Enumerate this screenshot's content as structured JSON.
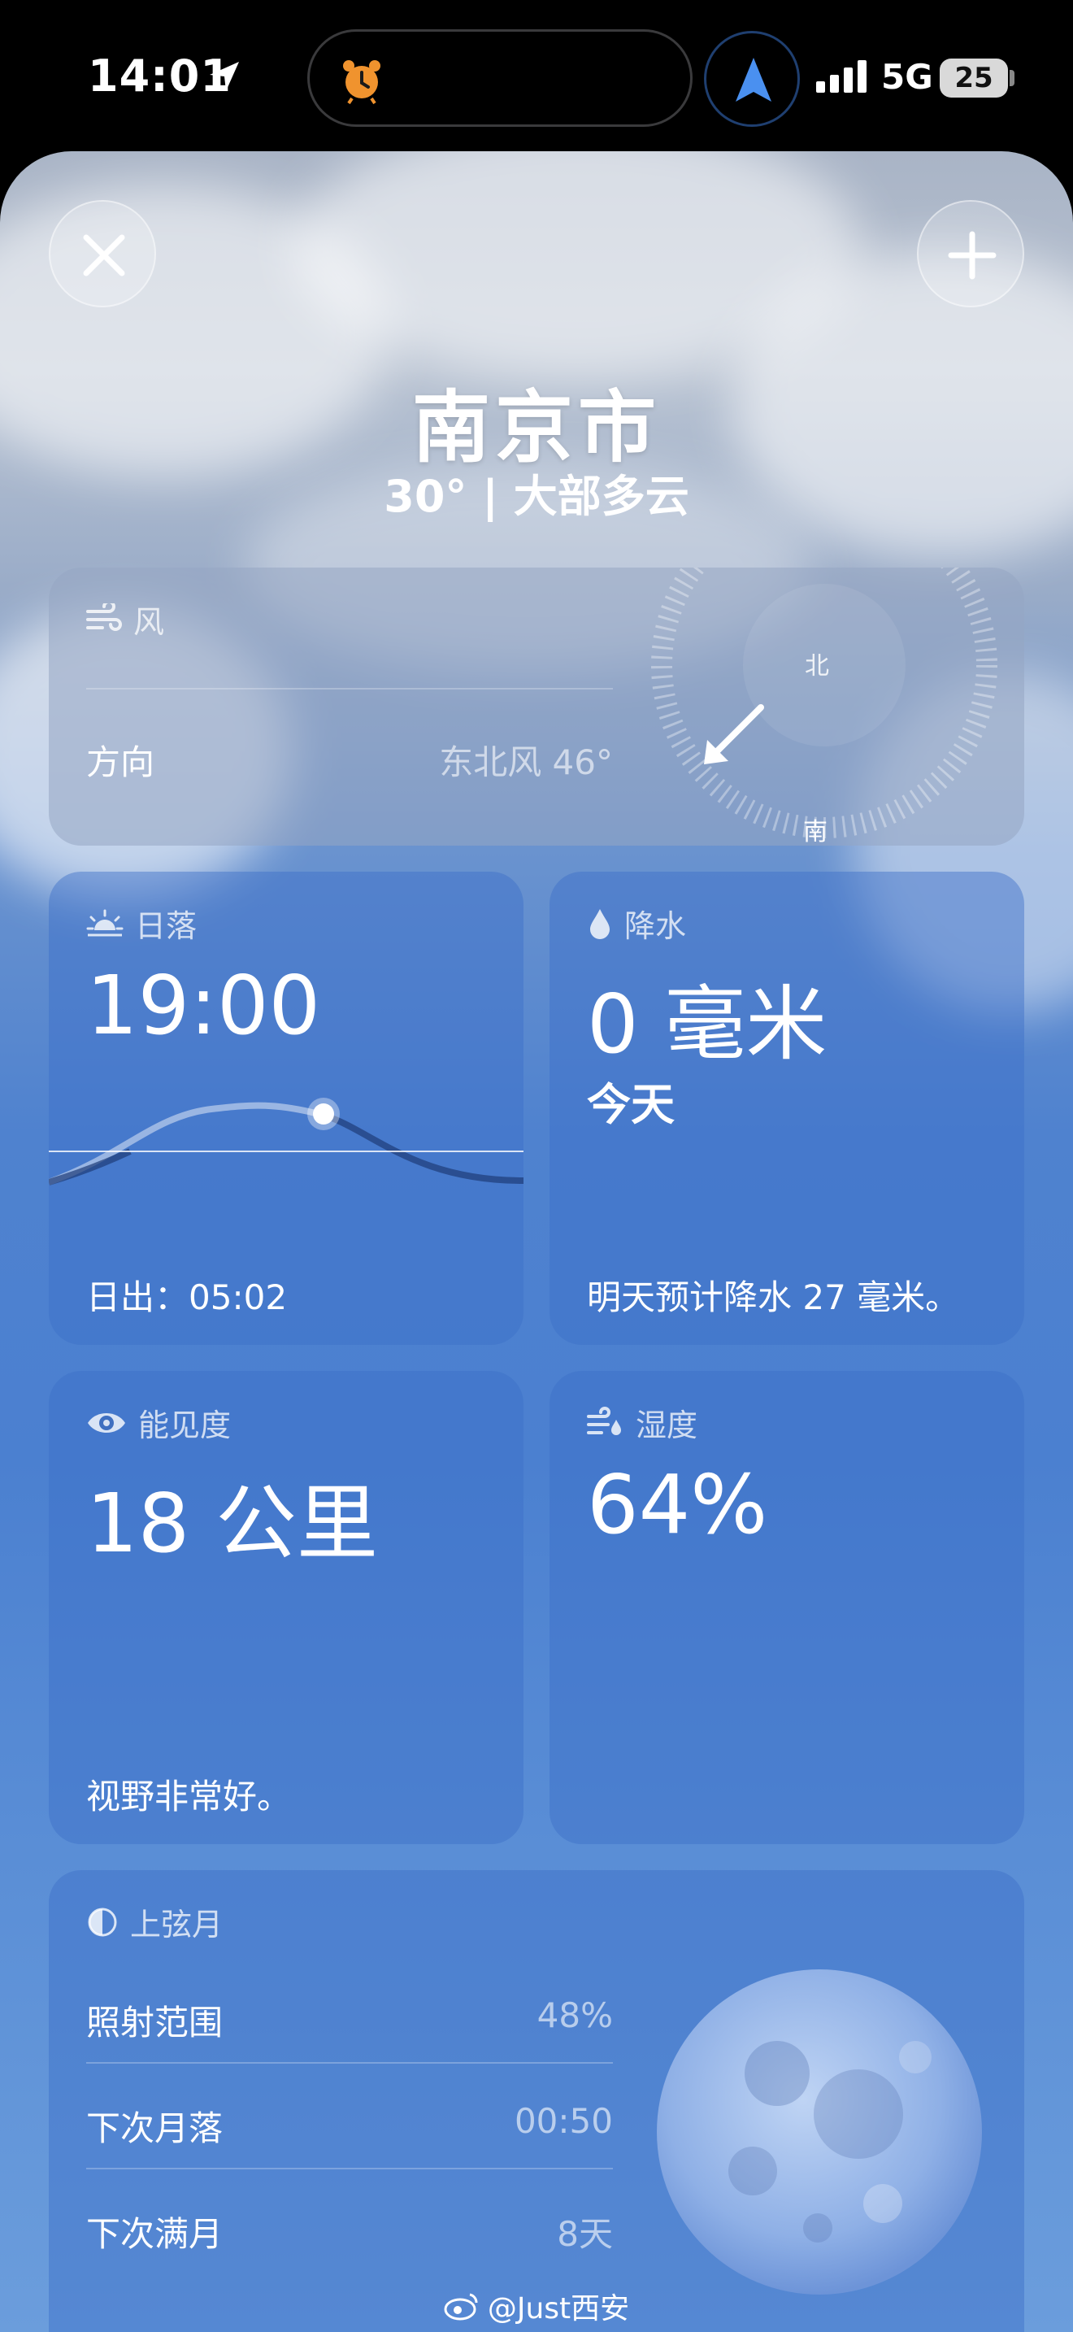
{
  "status_bar": {
    "time": "14:01",
    "network": "5G",
    "battery": "25"
  },
  "header": {
    "city": "南京市",
    "condition": "30° | 大部多云"
  },
  "wind": {
    "title": "风",
    "direction_label": "方向",
    "direction_value": "东北风 46°",
    "compass_north": "北",
    "compass_south": "南"
  },
  "sunset": {
    "title": "日落",
    "time": "19:00",
    "sunrise": "日出：05:02"
  },
  "precipitation": {
    "title": "降水",
    "amount": "0 毫米",
    "period": "今天",
    "note": "明天预计降水 27 毫米。"
  },
  "visibility": {
    "title": "能见度",
    "value": "18 公里",
    "note": "视野非常好。"
  },
  "humidity": {
    "title": "湿度",
    "value": "64%"
  },
  "moon": {
    "title": "上弦月",
    "rows": [
      {
        "label": "照射范围",
        "value": "48%"
      },
      {
        "label": "下次月落",
        "value": "00:50"
      },
      {
        "label": "下次满月",
        "value": "8天"
      }
    ]
  },
  "watermark": "@Just西安",
  "icons": {
    "location": "location-arrow-icon",
    "alarm": "alarm-icon",
    "navigation": "navigation-arrow-icon",
    "close": "close-icon",
    "add": "plus-icon"
  }
}
